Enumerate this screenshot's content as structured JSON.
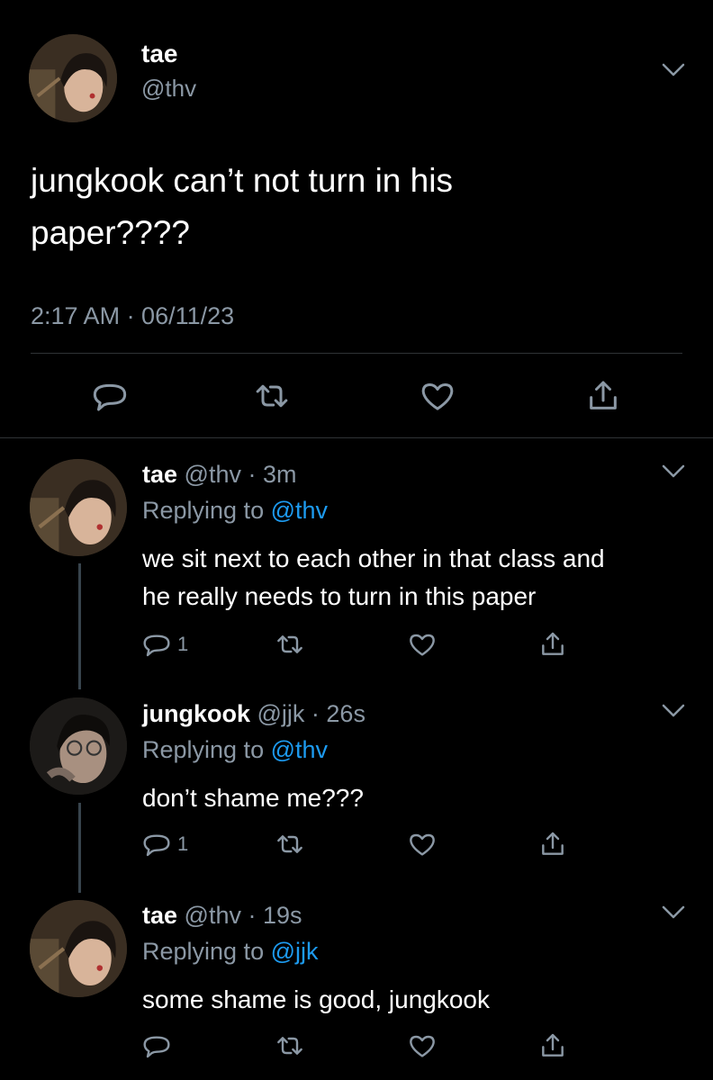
{
  "main_tweet": {
    "author_name": "tae",
    "author_handle": "@thv",
    "text_line1": "jungkook can’t not turn in his",
    "text_line2": "paper????",
    "timestamp": "2:17 AM · 06/11/23"
  },
  "replies": [
    {
      "author_name": "tae",
      "meta": "@thv · 3m",
      "replying_prefix": "Replying to ",
      "replying_handle": "@thv",
      "text_line1": "we sit next to each other in that class and",
      "text_line2": "he really needs to turn in this paper",
      "reply_count": "1"
    },
    {
      "author_name": "jungkook",
      "meta": "@jjk · 26s",
      "replying_prefix": "Replying to ",
      "replying_handle": "@thv",
      "text_line1": "don’t shame me???",
      "reply_count": "1"
    },
    {
      "author_name": "tae",
      "meta": "@thv · 19s",
      "replying_prefix": "Replying to ",
      "replying_handle": "@jjk",
      "text_line1": "some shame is good, jungkook"
    }
  ],
  "colors": {
    "background": "#000000",
    "secondary_text": "#8b98a5",
    "link_blue": "#1d9bf0",
    "divider": "#2f3336"
  },
  "icons": [
    "chevron-down-icon",
    "reply-icon",
    "retweet-icon",
    "like-icon",
    "share-icon"
  ]
}
